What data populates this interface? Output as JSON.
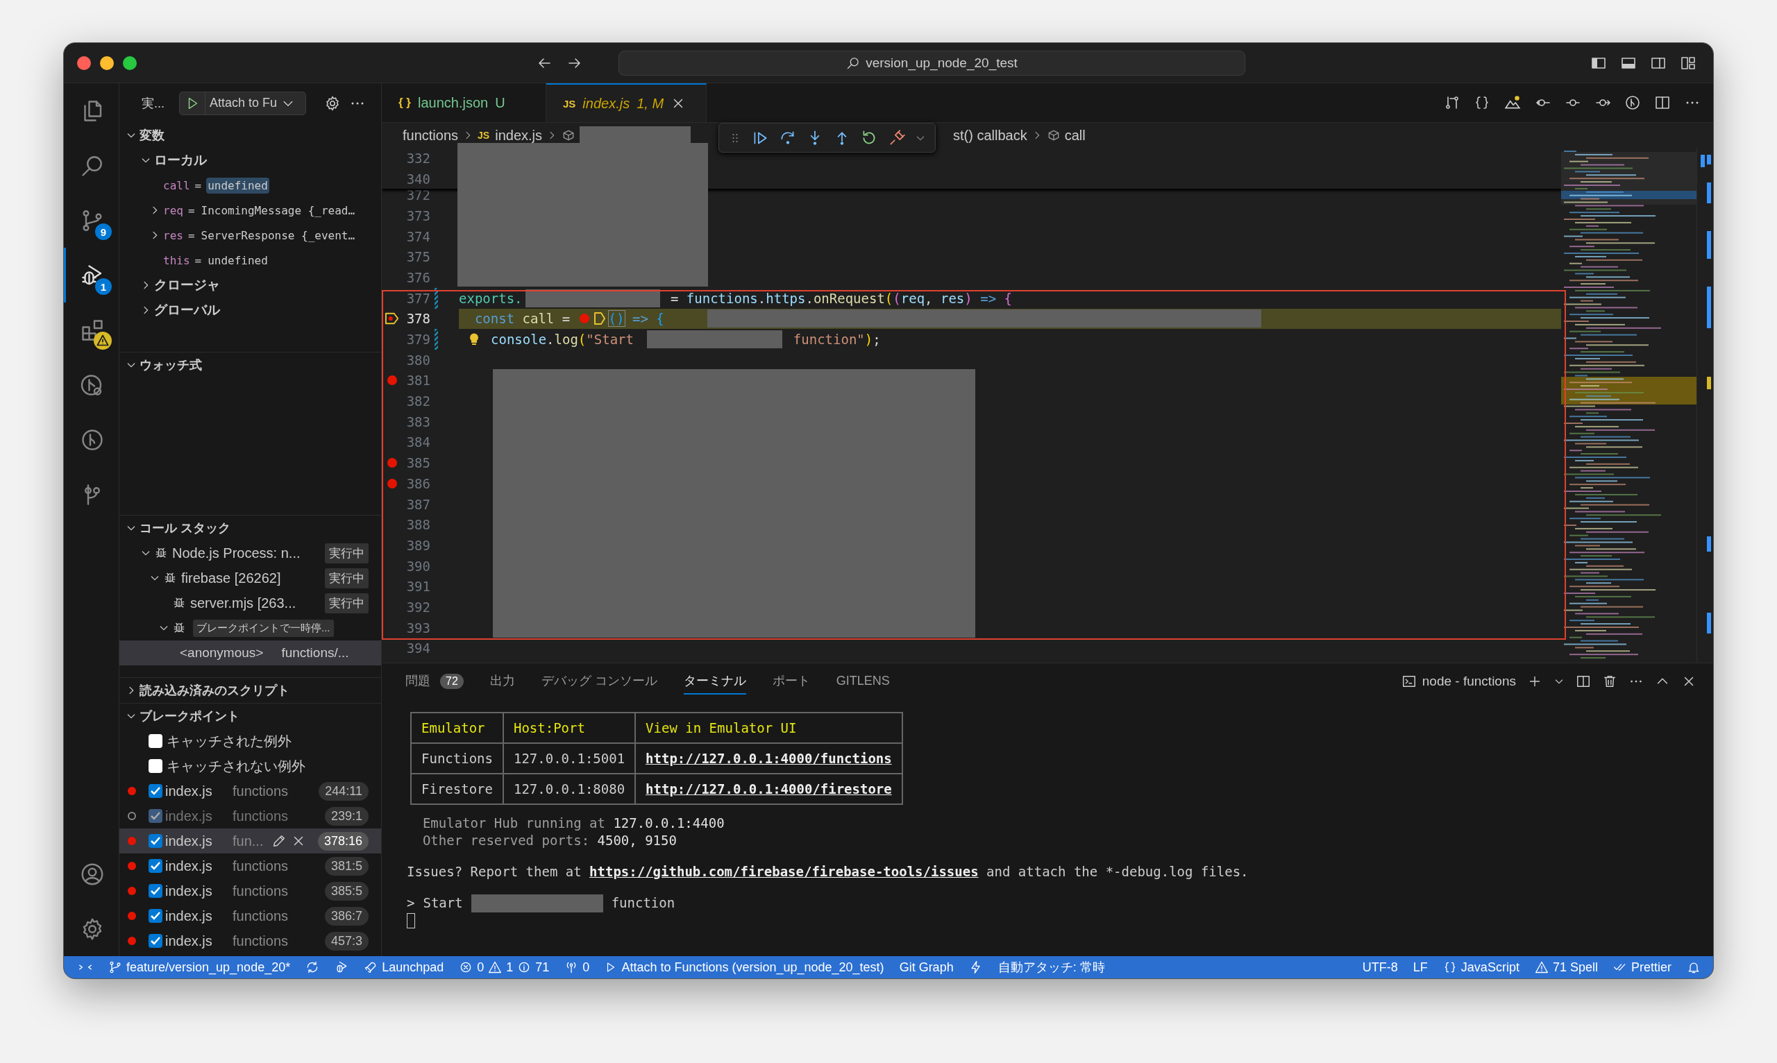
{
  "window": {
    "title": "version_up_node_20_test"
  },
  "activity_bar": {
    "items": [
      {
        "kind": "files",
        "selected": false
      },
      {
        "kind": "search",
        "selected": false
      },
      {
        "kind": "source-control",
        "badge": "9",
        "selected": false
      },
      {
        "kind": "run-debug",
        "badge": "1",
        "selected": true
      },
      {
        "kind": "extensions",
        "warning": true,
        "selected": false
      },
      {
        "kind": "remote",
        "selected": false
      },
      {
        "kind": "branch-circle",
        "selected": false
      },
      {
        "kind": "graph",
        "selected": false
      }
    ]
  },
  "sidebar": {
    "title": "実...",
    "launch_config": "Attach to Fu",
    "variables": {
      "title": "変数",
      "expanded": true,
      "children": [
        {
          "label": "ローカル",
          "expanded": true,
          "children": [
            {
              "name": "call",
              "operator": "=",
              "value": "undefined",
              "changed": true
            },
            {
              "name": "req",
              "operator": "=",
              "value": "IncomingMessage {_read…",
              "expanded": false,
              "changed": false
            },
            {
              "name": "res",
              "operator": "=",
              "value": "ServerResponse {_event…",
              "expanded": false,
              "changed": false
            },
            {
              "name": "this",
              "operator": "=",
              "value": "undefined",
              "changed": false
            }
          ]
        },
        {
          "label": "クロージャ",
          "expanded": false
        },
        {
          "label": "グローバル",
          "expanded": false
        }
      ]
    },
    "watch": {
      "title": "ウォッチ式",
      "expanded": true
    },
    "call_stack": {
      "title": "コール スタック",
      "expanded": true,
      "children": [
        {
          "kind": "session",
          "label": "Node.js Process: n...",
          "status": "実行中",
          "expanded": true,
          "children": [
            {
              "kind": "session",
              "label": "firebase [26262]",
              "status": "実行中",
              "expanded": true,
              "children": [
                {
                  "kind": "session",
                  "label": "server.mjs [263...",
                  "status": "実行中"
                },
                {
                  "kind": "session",
                  "status": "ブレークポイントで一時停...",
                  "expanded": true,
                  "children": [
                    {
                      "kind": "frame",
                      "name": "<anonymous>",
                      "source": "functions/...",
                      "selected": true
                    }
                  ]
                }
              ]
            }
          ]
        }
      ]
    },
    "loaded_scripts": {
      "title": "読み込み済みのスクリプト",
      "expanded": false
    },
    "breakpoints": {
      "title": "ブレークポイント",
      "expanded": true,
      "exceptions": [
        {
          "label": "キャッチされた例外",
          "checked": false
        },
        {
          "label": "キャッチされない例外",
          "checked": false
        }
      ],
      "items": [
        {
          "file": "index.js",
          "folder": "functions",
          "location": "244:11",
          "checked": true,
          "enabled": true,
          "selected": false
        },
        {
          "file": "index.js",
          "folder": "functions",
          "location": "239:1",
          "checked": true,
          "enabled": false,
          "selected": false
        },
        {
          "file": "index.js",
          "folder": "fun...",
          "location": "378:16",
          "checked": true,
          "enabled": true,
          "selected": true
        },
        {
          "file": "index.js",
          "folder": "functions",
          "location": "381:5",
          "checked": true,
          "enabled": true,
          "selected": false
        },
        {
          "file": "index.js",
          "folder": "functions",
          "location": "385:5",
          "checked": true,
          "enabled": true,
          "selected": false
        },
        {
          "file": "index.js",
          "folder": "functions",
          "location": "386:7",
          "checked": true,
          "enabled": true,
          "selected": false
        },
        {
          "file": "index.js",
          "folder": "functions",
          "location": "457:3",
          "checked": true,
          "enabled": true,
          "selected": false
        }
      ]
    }
  },
  "editor": {
    "tabs": [
      {
        "kind": "json",
        "icon_text": "{ }",
        "label": "launch.json",
        "decoration": "U",
        "selected": false
      },
      {
        "kind": "js",
        "icon_text": "JS",
        "label": "index.js",
        "decoration": "1, M",
        "selected": true
      }
    ],
    "breadcrumbs": [
      {
        "kind": "folder",
        "text": "functions"
      },
      {
        "kind": "file",
        "icon_text": "JS",
        "text": "index.js"
      },
      {
        "kind": "symbol-redacted"
      },
      {
        "kind": "partial",
        "text": "st() callback"
      },
      {
        "kind": "symbol",
        "text": "call"
      }
    ],
    "sticky_lines": [
      {
        "number": "332"
      },
      {
        "number": "340"
      }
    ],
    "lines": [
      {
        "number": "372",
        "breakpoint": false,
        "paused": false,
        "modified": false
      },
      {
        "number": "373",
        "breakpoint": false,
        "paused": false,
        "modified": false
      },
      {
        "number": "374",
        "breakpoint": false,
        "paused": false,
        "modified": false
      },
      {
        "number": "375",
        "breakpoint": false,
        "paused": false,
        "modified": false
      },
      {
        "number": "376",
        "breakpoint": false,
        "paused": false,
        "modified": false
      },
      {
        "number": "377",
        "breakpoint": false,
        "paused": false,
        "modified": true,
        "tokens": [
          {
            "kind": "variable",
            "text": "exports."
          },
          {
            "kind": "redacted"
          },
          {
            "kind": "plain",
            "text": " = "
          },
          {
            "kind": "object",
            "text": "functions"
          },
          {
            "kind": "plain",
            "text": "."
          },
          {
            "kind": "object",
            "text": "https"
          },
          {
            "kind": "plain",
            "text": "."
          },
          {
            "kind": "function",
            "text": "onRequest"
          },
          {
            "kind": "bracket1",
            "text": "("
          },
          {
            "kind": "bracket2",
            "text": "("
          },
          {
            "kind": "param",
            "text": "req"
          },
          {
            "kind": "plain",
            "text": ", "
          },
          {
            "kind": "param",
            "text": "res"
          },
          {
            "kind": "bracket2",
            "text": ")"
          },
          {
            "kind": "keyword",
            "text": " => "
          },
          {
            "kind": "bracket2",
            "text": "{"
          }
        ]
      },
      {
        "number": "378",
        "breakpoint": true,
        "paused": true,
        "modified": false,
        "tokens": [
          {
            "kind": "keyword",
            "text": "  const "
          },
          {
            "kind": "function",
            "text": "call"
          },
          {
            "kind": "plain",
            "text": " = "
          },
          {
            "kind": "breakpoint-marker"
          },
          {
            "kind": "paused-marker"
          },
          {
            "kind": "bracket-boxed",
            "text": "()"
          },
          {
            "kind": "keyword",
            "text": " => "
          },
          {
            "kind": "bracket3",
            "text": "{"
          },
          {
            "kind": "redacted"
          }
        ]
      },
      {
        "number": "379",
        "breakpoint": false,
        "paused": false,
        "modified": true,
        "tokens": [
          {
            "kind": "lightbulb"
          },
          {
            "kind": "object",
            "text": "console"
          },
          {
            "kind": "plain",
            "text": "."
          },
          {
            "kind": "function",
            "text": "log"
          },
          {
            "kind": "bracket1",
            "text": "("
          },
          {
            "kind": "string",
            "text": "\"Start "
          },
          {
            "kind": "redacted"
          },
          {
            "kind": "string",
            "text": " function\""
          },
          {
            "kind": "bracket1",
            "text": ")"
          },
          {
            "kind": "plain",
            "text": ";"
          }
        ]
      },
      {
        "number": "380",
        "breakpoint": false,
        "paused": false,
        "modified": false
      },
      {
        "number": "381",
        "breakpoint": true,
        "paused": false,
        "modified": false
      },
      {
        "number": "382",
        "breakpoint": false,
        "paused": false,
        "modified": false
      },
      {
        "number": "383",
        "breakpoint": false,
        "paused": false,
        "modified": false
      },
      {
        "number": "384",
        "breakpoint": false,
        "paused": false,
        "modified": false
      },
      {
        "number": "385",
        "breakpoint": true,
        "paused": false,
        "modified": false
      },
      {
        "number": "386",
        "breakpoint": true,
        "paused": false,
        "modified": false
      },
      {
        "number": "387",
        "breakpoint": false,
        "paused": false,
        "modified": false
      },
      {
        "number": "388",
        "breakpoint": false,
        "paused": false,
        "modified": false
      },
      {
        "number": "389",
        "breakpoint": false,
        "paused": false,
        "modified": false
      },
      {
        "number": "390",
        "breakpoint": false,
        "paused": false,
        "modified": false
      },
      {
        "number": "391",
        "breakpoint": false,
        "paused": false,
        "modified": false
      },
      {
        "number": "392",
        "breakpoint": false,
        "paused": false,
        "modified": false
      },
      {
        "number": "393",
        "breakpoint": false,
        "paused": false,
        "modified": false
      },
      {
        "number": "394",
        "breakpoint": false,
        "paused": false,
        "modified": false
      }
    ]
  },
  "panel": {
    "tabs": [
      {
        "label": "問題",
        "badge": "72",
        "selected": false
      },
      {
        "label": "出力",
        "selected": false
      },
      {
        "label": "デバッグ コンソール",
        "selected": false
      },
      {
        "label": "ターミナル",
        "selected": true
      },
      {
        "label": "ポート",
        "selected": false
      },
      {
        "label": "GITLENS",
        "selected": false
      }
    ],
    "terminal_name": "node - functions",
    "terminal": {
      "table": {
        "columns": [
          "Emulator",
          "Host:Port",
          "View in Emulator UI"
        ],
        "rows": [
          [
            "Functions",
            "127.0.0.1:5001",
            "http://127.0.0.1:4000/functions"
          ],
          [
            "Firestore",
            "127.0.0.1:8080",
            "http://127.0.0.1:4000/firestore"
          ]
        ]
      },
      "info_lines": [
        "  Emulator Hub running at **127.0.0.1:4400**",
        "  Other reserved ports: **4500, 9150**"
      ],
      "issues": {
        "before": "Issues? Report them at ",
        "link": "https://github.com/firebase/firebase-tools/issues",
        "after": " and attach the *-debug.log files."
      },
      "prompt": {
        "symbol": ">",
        "before": "Start",
        "after": "function"
      }
    }
  },
  "status_bar": {
    "branch": "feature/version_up_node_20*",
    "launchpad": "Launchpad",
    "errors": "0",
    "warnings": "1",
    "infos": "71",
    "ports": "0",
    "debug": "Attach to Functions (version_up_node_20_test)",
    "git_graph": "Git Graph",
    "auto_attach": "自動アタッチ: 常時",
    "encoding": "UTF-8",
    "eol": "LF",
    "language": "JavaScript",
    "spell": "71 Spell",
    "prettier": "Prettier"
  }
}
